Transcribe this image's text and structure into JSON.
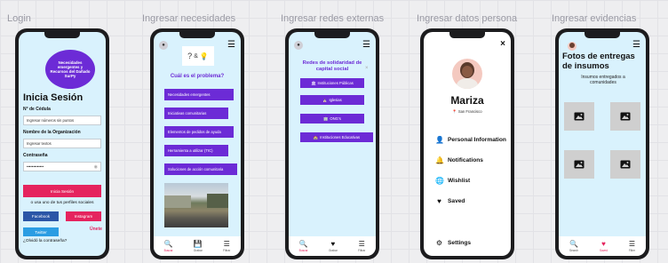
{
  "frames": [
    {
      "label": "Login"
    },
    {
      "label": "Ingresar necesidades"
    },
    {
      "label": "Ingresar redes externas"
    },
    {
      "label": "Ingresar datos persona"
    },
    {
      "label": "Ingresar evidencias"
    }
  ],
  "login": {
    "logo_text": "Necesidades emergentes y Recursos del Dañado SurPy",
    "title": "Inicia Sesión",
    "id_label": "N° de Cédula",
    "id_value": "Ingresar números sin puntos",
    "org_label": "Nombre de la Organización",
    "org_value": "Ingresar textos",
    "password_label": "Contraseña",
    "password_value": "•••••••••••••",
    "login_button": "Inicia Sesión",
    "social_text": "o usa uno de tus perfiles sociales",
    "facebook": "Facebook",
    "instagram": "Instagram",
    "twitter": "Twitter",
    "register": "Únete",
    "forgot": "¿Olvidó la contraseña?"
  },
  "needs": {
    "question": "Cuál es el problema?",
    "buttons": [
      "Necesidades emergentes",
      "Iniciativas comunitarias",
      "Elementos de pedidos de ayuda",
      "Herramienta a utilizar (TIC)",
      "Soluciones de acción comunitaria"
    ]
  },
  "networks": {
    "title": "Redes de solidaridad de capital social",
    "close": "×",
    "buttons": [
      {
        "icon": "🏛",
        "label": "Instituciones Públicas"
      },
      {
        "icon": "⛪",
        "label": "Iglesias"
      },
      {
        "icon": "🏢",
        "label": "ONG's"
      },
      {
        "icon": "🏫",
        "label": "Instituciones Educativas"
      }
    ]
  },
  "nav_needs": [
    {
      "icon": "🔍",
      "label": "Buscar"
    },
    {
      "icon": "💾",
      "label": "Grabar"
    },
    {
      "icon": "☰",
      "label": "Filtrar"
    }
  ],
  "nav_networks": [
    {
      "icon": "🔍",
      "label": "Buscar"
    },
    {
      "icon": "♥",
      "label": "Grabar"
    },
    {
      "icon": "☰",
      "label": "Filtrar"
    }
  ],
  "nav_evidence": [
    {
      "icon": "🔍",
      "label": "Search"
    },
    {
      "icon": "♥",
      "label": "Saved"
    },
    {
      "icon": "☰",
      "label": "Filter"
    }
  ],
  "profile": {
    "name": "Mariza",
    "location": "San Francisco",
    "close": "×",
    "menu": [
      {
        "icon": "👤",
        "label": "Personal Information"
      },
      {
        "icon": "🔔",
        "label": "Notifications"
      },
      {
        "icon": "🌐",
        "label": "Wishlist"
      },
      {
        "icon": "♥",
        "label": "Saved"
      }
    ],
    "settings": "Settings"
  },
  "evidence": {
    "title": "Fotos de entregas de insumos",
    "subtitle": "Insumos entregados a comunidades"
  },
  "colors": {
    "screen_bg": "#d9f2fd",
    "purple": "#6c2bd6",
    "pink": "#e5245e",
    "facebook_blue": "#2b56a7",
    "twitter_blue": "#2b9de3"
  }
}
